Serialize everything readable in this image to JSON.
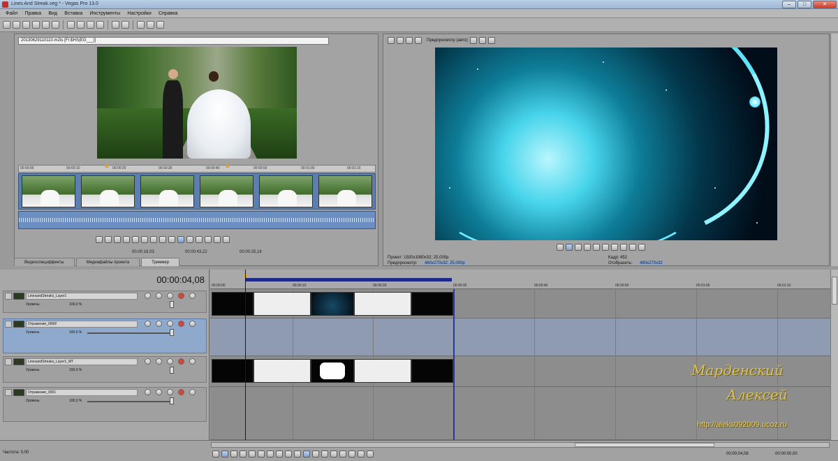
{
  "window": {
    "title": "Lines And Streak.veg * - Vegas Pro 13.0",
    "min_label": "–",
    "max_label": "□",
    "close_label": "✕"
  },
  "menu": [
    "Файл",
    "Правка",
    "Вид",
    "Вставка",
    "Инструменты",
    "Настройки",
    "Справка"
  ],
  "trimmer": {
    "path": "20130629110110.m2ts   [Fr:$HS(EG___)]",
    "ruler": [
      "00:00:00",
      "00:00:10",
      "00:00:20",
      "00:00:30",
      "00:00:40",
      "00:00:50",
      "00:01:00",
      "00:01:10"
    ],
    "time_in": "00:00:18,03",
    "time_out": "00:00:43,22",
    "time_len": "00:00:25,18"
  },
  "tabs": [
    "Видеоспецэффекты",
    "Медиафайлы проекта",
    "Триммер"
  ],
  "preview": {
    "mode": "Предпросмотр (авто)",
    "project_label": "Проект:",
    "project_value": "1920x1080x32; 25,000p",
    "prev_label": "Предпросмотр:",
    "prev_value": "480x270x32; 25,000p",
    "frame_label": "Кадр:",
    "frame_value": "452",
    "display_label": "Отобразить:",
    "display_value": "480x270x32"
  },
  "timeline": {
    "timecode": "00:00:04,08",
    "ruler": [
      "00:00:00",
      "00:00:10",
      "00:00:20",
      "00:00:30",
      "00:00:40",
      "00:00:50",
      "00:01:00",
      "00:01:10"
    ],
    "tracks": [
      {
        "name": "LinesandStreaks_Layer1",
        "level_label": "Уровень:",
        "level_value": "100,0 %"
      },
      {
        "name": "Отражение_0000!",
        "level_label": "Уровень:",
        "level_value": "100,0 %"
      },
      {
        "name": "LinesandStreaks_Layer1_MT",
        "level_label": "Уровень:",
        "level_value": "100,0 %"
      },
      {
        "name": "Отражение_0001",
        "level_label": "Уровень:",
        "level_value": "100,0 %"
      }
    ]
  },
  "watermark": {
    "line1": "Марденский",
    "line2": "Алексей",
    "url": "http://aleks092009.ucoz.ru"
  },
  "status": {
    "rate": "Частота: 0,00",
    "tc1": "00:00:04,08",
    "tc2": "00:00:00,00"
  }
}
